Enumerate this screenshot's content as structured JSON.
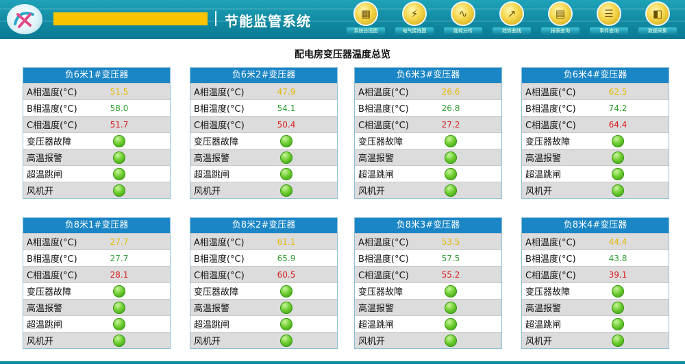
{
  "header": {
    "app_title": "节能监管系统",
    "accent_color": "#f8c400",
    "nav": [
      {
        "label": "系统总揽图",
        "icon": "overview-icon"
      },
      {
        "label": "电气接线图",
        "icon": "wiring-icon"
      },
      {
        "label": "能耗分析",
        "icon": "analysis-icon"
      },
      {
        "label": "趋势曲线",
        "icon": "trend-icon"
      },
      {
        "label": "报表查询",
        "icon": "report-icon"
      },
      {
        "label": "事件查询",
        "icon": "event-icon"
      },
      {
        "label": "数据采集",
        "icon": "data-collect-icon"
      }
    ]
  },
  "page_title": "配电房变压器温度总览",
  "status_colors": {
    "a": "#e6b800",
    "b": "#2e9e2e",
    "c": "#d92020",
    "ok": "#5cbf28"
  },
  "transformers": [
    {
      "name": "负6米1#变压器",
      "rows": [
        {
          "label": "A相温度(°C)",
          "value": "51.5"
        },
        {
          "label": "B相温度(°C)",
          "value": "58.0"
        },
        {
          "label": "C相温度(°C)",
          "value": "51.7"
        },
        {
          "label": "变压器故障",
          "status": "normal"
        },
        {
          "label": "高温报警",
          "status": "normal"
        },
        {
          "label": "超温跳闸",
          "status": "normal"
        },
        {
          "label": "风机开",
          "status": "normal"
        }
      ]
    },
    {
      "name": "负6米2#变压器",
      "rows": [
        {
          "label": "A相温度(°C)",
          "value": "47.9"
        },
        {
          "label": "B相温度(°C)",
          "value": "54.1"
        },
        {
          "label": "C相温度(°C)",
          "value": "50.4"
        },
        {
          "label": "变压器故障",
          "status": "normal"
        },
        {
          "label": "高温报警",
          "status": "normal"
        },
        {
          "label": "超温跳闸",
          "status": "normal"
        },
        {
          "label": "风机开",
          "status": "normal"
        }
      ]
    },
    {
      "name": "负6米3#变压器",
      "rows": [
        {
          "label": "A相温度(°C)",
          "value": "26.6"
        },
        {
          "label": "B相温度(°C)",
          "value": "26.8"
        },
        {
          "label": "C相温度(°C)",
          "value": "27.2"
        },
        {
          "label": "变压器故障",
          "status": "normal"
        },
        {
          "label": "高温报警",
          "status": "normal"
        },
        {
          "label": "超温跳闸",
          "status": "normal"
        },
        {
          "label": "风机开",
          "status": "normal"
        }
      ]
    },
    {
      "name": "负6米4#变压器",
      "rows": [
        {
          "label": "A相温度(°C)",
          "value": "62.5"
        },
        {
          "label": "B相温度(°C)",
          "value": "74.2"
        },
        {
          "label": "C相温度(°C)",
          "value": "64.4"
        },
        {
          "label": "变压器故障",
          "status": "normal"
        },
        {
          "label": "高温报警",
          "status": "normal"
        },
        {
          "label": "超温跳闸",
          "status": "normal"
        },
        {
          "label": "风机开",
          "status": "normal"
        }
      ]
    },
    {
      "name": "负8米1#变压器",
      "rows": [
        {
          "label": "A相温度(°C)",
          "value": "27.7"
        },
        {
          "label": "B相温度(°C)",
          "value": "27.7"
        },
        {
          "label": "C相温度(°C)",
          "value": "28.1"
        },
        {
          "label": "变压器故障",
          "status": "normal"
        },
        {
          "label": "高温报警",
          "status": "normal"
        },
        {
          "label": "超温跳闸",
          "status": "normal"
        },
        {
          "label": "风机开",
          "status": "normal"
        }
      ]
    },
    {
      "name": "负8米2#变压器",
      "rows": [
        {
          "label": "A相温度(°C)",
          "value": "61.1"
        },
        {
          "label": "B相温度(°C)",
          "value": "65.9"
        },
        {
          "label": "C相温度(°C)",
          "value": "60.5"
        },
        {
          "label": "变压器故障",
          "status": "normal"
        },
        {
          "label": "高温报警",
          "status": "normal"
        },
        {
          "label": "超温跳闸",
          "status": "normal"
        },
        {
          "label": "风机开",
          "status": "normal"
        }
      ]
    },
    {
      "name": "负8米3#变压器",
      "rows": [
        {
          "label": "A相温度(°C)",
          "value": "53.5"
        },
        {
          "label": "B相温度(°C)",
          "value": "57.5"
        },
        {
          "label": "C相温度(°C)",
          "value": "55.2"
        },
        {
          "label": "变压器故障",
          "status": "normal"
        },
        {
          "label": "高温报警",
          "status": "normal"
        },
        {
          "label": "超温跳闸",
          "status": "normal"
        },
        {
          "label": "风机开",
          "status": "normal"
        }
      ]
    },
    {
      "name": "负8米4#变压器",
      "rows": [
        {
          "label": "A相温度(°C)",
          "value": "44.4"
        },
        {
          "label": "B相温度(°C)",
          "value": "43.8"
        },
        {
          "label": "C相温度(°C)",
          "value": "39.1"
        },
        {
          "label": "变压器故障",
          "status": "normal"
        },
        {
          "label": "高温报警",
          "status": "normal"
        },
        {
          "label": "超温跳闸",
          "status": "normal"
        },
        {
          "label": "风机开",
          "status": "normal"
        }
      ]
    }
  ]
}
